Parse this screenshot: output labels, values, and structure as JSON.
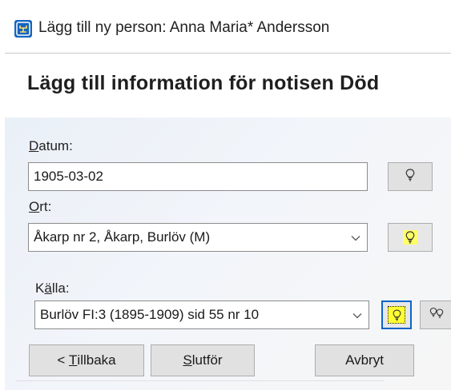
{
  "window": {
    "title": "Lägg till ny person: Anna Maria* Andersson",
    "app_icon": "family-tree-icon"
  },
  "heading": "Lägg till information för notisen Död",
  "fields": {
    "date": {
      "label_underlined": "D",
      "label_rest": "atum:",
      "value": "1905-03-02"
    },
    "place": {
      "label_underlined": "O",
      "label_rest": "rt:",
      "value": "Åkarp nr 2, Åkarp, Burlöv (M)"
    },
    "source": {
      "label_pre": "K",
      "label_underlined": "ä",
      "label_rest": "lla:",
      "value": "Burlöv FI:3 (1895-1909) sid 55 nr 10"
    }
  },
  "buttons": {
    "back_pre": "< ",
    "back_underlined": "T",
    "back_rest": "illbaka",
    "finish_underlined": "S",
    "finish_rest": "lutför",
    "cancel": "Avbryt"
  },
  "icons": {
    "lightbulb": "lightbulb-icon",
    "double_lightbulb": "double-lightbulb-icon",
    "dropdown": "chevron-down-icon"
  },
  "colors": {
    "accent": "#0a64c8",
    "highlight": "#ffff33"
  }
}
